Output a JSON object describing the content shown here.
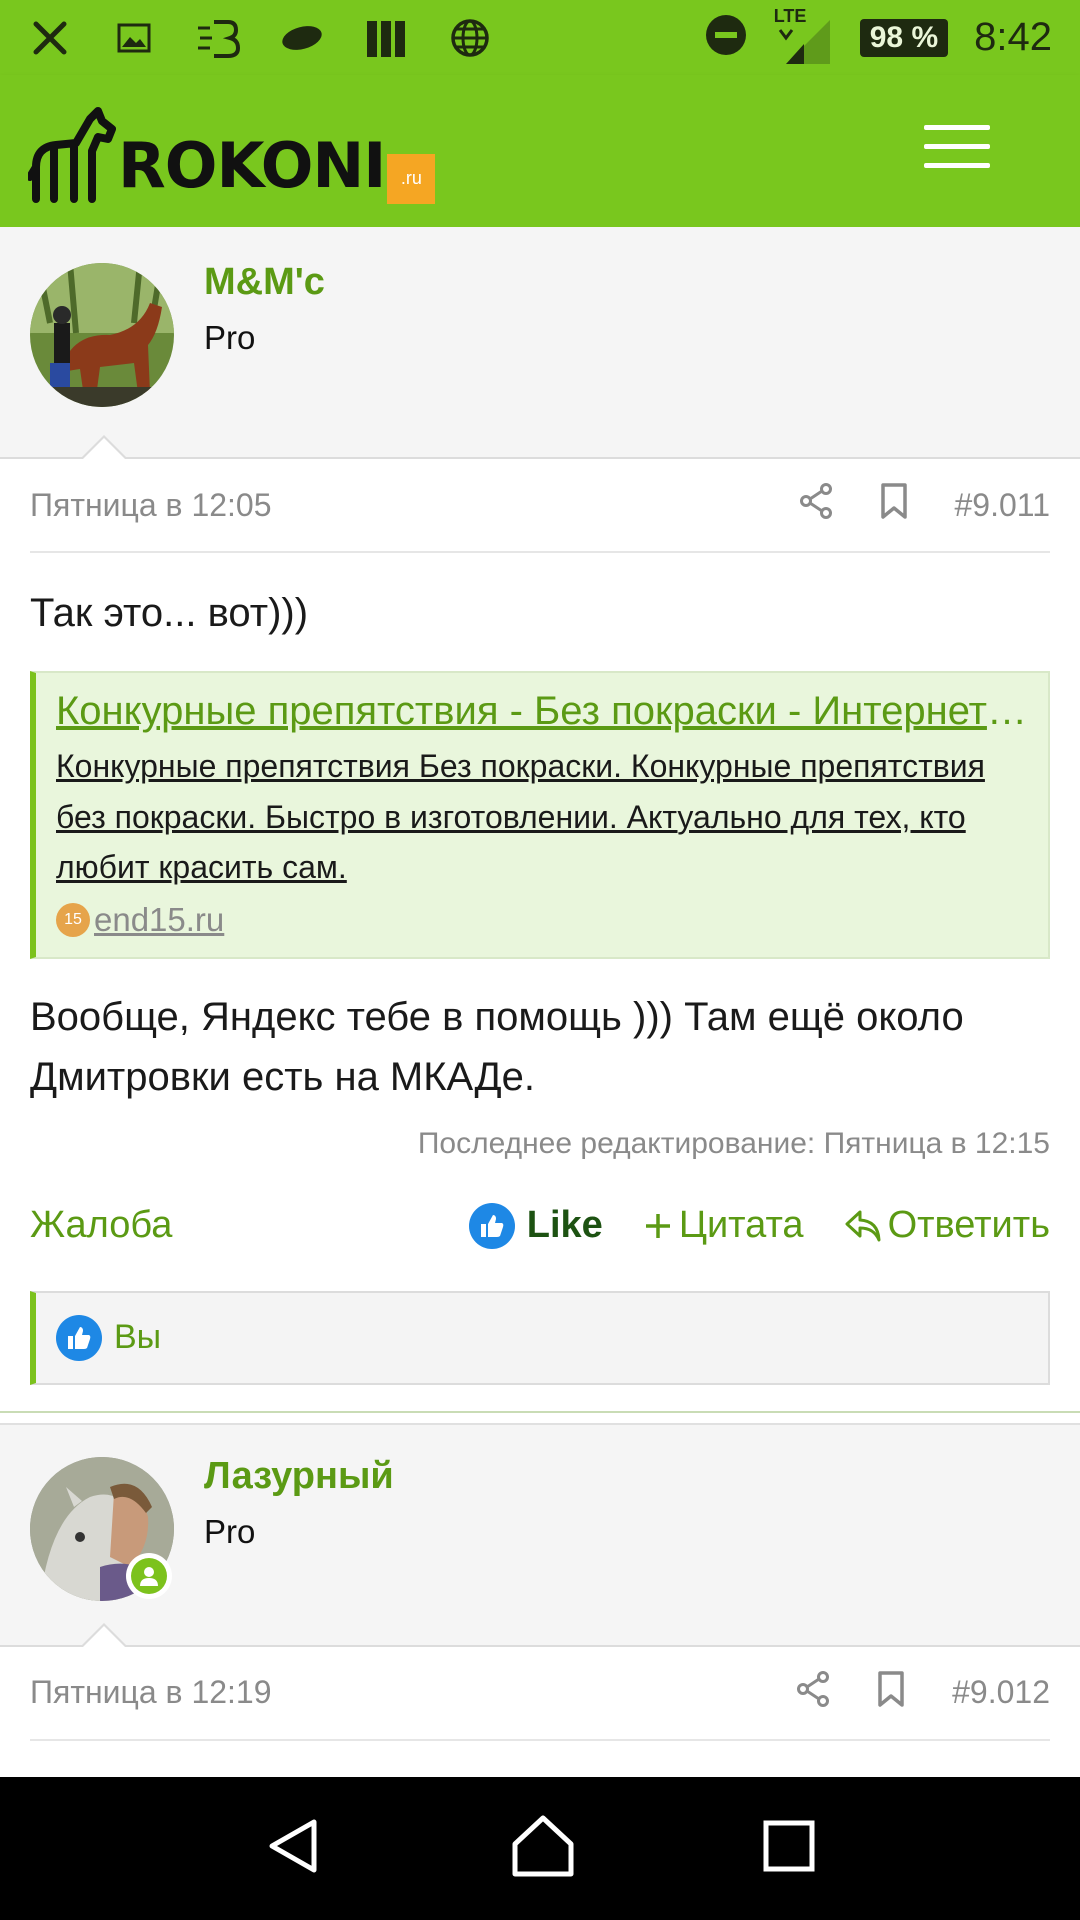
{
  "status_bar": {
    "icons": [
      "cutlery-icon",
      "image-icon",
      "b-logo-icon",
      "leaf-icon",
      "books-icon",
      "globe-icon"
    ],
    "right_icons": [
      "do-not-disturb-icon",
      "lte-signal-icon"
    ],
    "network": "LTE",
    "battery": "98 %",
    "time": "8:42"
  },
  "header": {
    "logo_text": "ROKONI",
    "logo_domain": ".ru",
    "menu_icon": "hamburger-menu-icon"
  },
  "post1": {
    "author": "M&M'c",
    "rank": "Pro",
    "timestamp": "Пятница в 12:05",
    "number": "#9.011",
    "text1": "Так это... вот)))",
    "link": {
      "title": "Конкурные препятствия - Без покраски - Интернет-магазин",
      "description": "Конкурные препятствия Без покраски. Конкурные препятствия без покраски. Быстро в изготовлении. Актуально для тех, кто любит красить сам.",
      "domain": " end15.ru",
      "favicon_text": "15"
    },
    "text2": "Вообще, Яндекс тебе в помощь ))) Там ещё около Дмитровки есть на МКАДе.",
    "edited": "Последнее редактирование: Пятница в 12:15",
    "complaint": "Жалоба",
    "like": "Like",
    "quote": "Цитата",
    "reply": "Ответить",
    "likes_by": "Вы"
  },
  "post2": {
    "author": "Лазурный",
    "rank": "Pro",
    "timestamp": "Пятница в 12:19",
    "number": "#9.012"
  },
  "colors": {
    "brand_green": "#79c71e",
    "link_green": "#5b9a14",
    "like_blue": "#1e88e5"
  }
}
